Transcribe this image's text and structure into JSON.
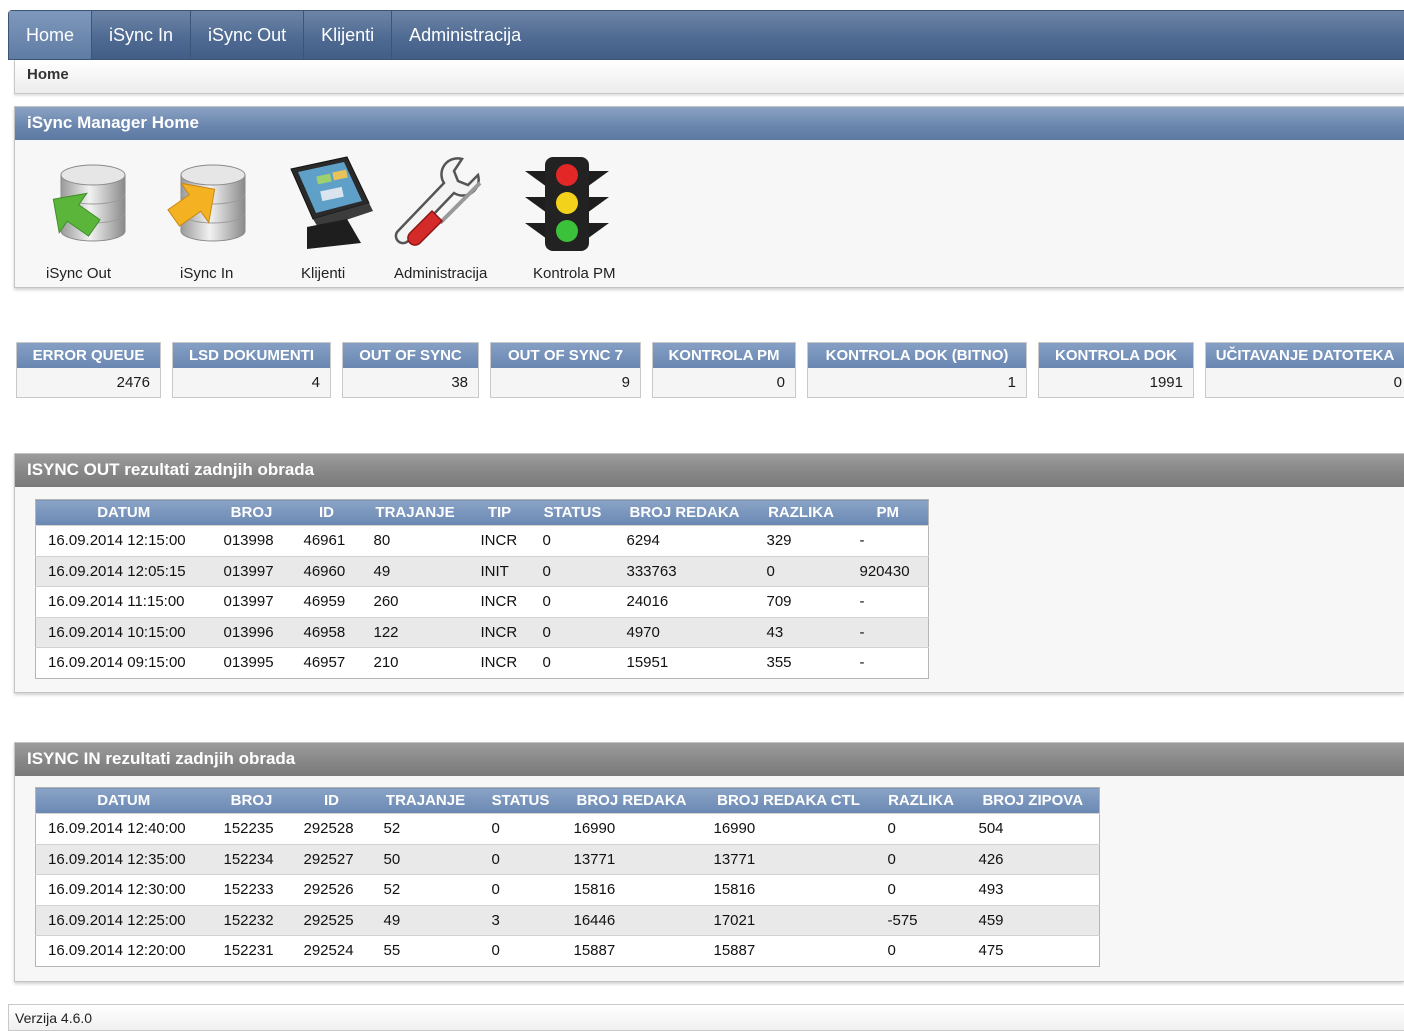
{
  "nav": {
    "tabs": [
      {
        "label": "Home",
        "active": true
      },
      {
        "label": "iSync In"
      },
      {
        "label": "iSync Out"
      },
      {
        "label": "Klijenti"
      },
      {
        "label": "Administracija"
      }
    ]
  },
  "breadcrumb": "Home",
  "home_region": {
    "title": "iSync Manager Home",
    "icons": [
      {
        "label": "iSync Out",
        "icon": "database-export-icon"
      },
      {
        "label": "iSync In",
        "icon": "database-import-icon"
      },
      {
        "label": "Klijenti",
        "icon": "pos-terminal-icon"
      },
      {
        "label": "Administracija",
        "icon": "wrench-screwdriver-icon"
      },
      {
        "label": "Kontrola PM",
        "icon": "traffic-light-icon"
      }
    ]
  },
  "stats": [
    {
      "label": "ERROR QUEUE",
      "value": "2476"
    },
    {
      "label": "LSD DOKUMENTI",
      "value": "4"
    },
    {
      "label": "OUT OF SYNC",
      "value": "38"
    },
    {
      "label": "OUT OF SYNC 7",
      "value": "9"
    },
    {
      "label": "KONTROLA PM",
      "value": "0"
    },
    {
      "label": "KONTROLA DOK (BITNO)",
      "value": "1"
    },
    {
      "label": "KONTROLA DOK",
      "value": "1991"
    },
    {
      "label": "UČITAVANJE DATOTEKA",
      "value": "0"
    }
  ],
  "isync_out": {
    "title": "ISYNC OUT rezultati zadnjih obrada",
    "columns": [
      "DATUM",
      "BROJ",
      "ID",
      "TRAJANJE",
      "TIP",
      "STATUS",
      "BROJ REDAKA",
      "RAZLIKA",
      "PM"
    ],
    "rows": [
      [
        "16.09.2014 12:15:00",
        "013998",
        "46961",
        "80",
        "INCR",
        "0",
        "6294",
        "329",
        "-"
      ],
      [
        "16.09.2014 12:05:15",
        "013997",
        "46960",
        "49",
        "INIT",
        "0",
        "333763",
        "0",
        "920430"
      ],
      [
        "16.09.2014 11:15:00",
        "013997",
        "46959",
        "260",
        "INCR",
        "0",
        "24016",
        "709",
        "-"
      ],
      [
        "16.09.2014 10:15:00",
        "013996",
        "46958",
        "122",
        "INCR",
        "0",
        "4970",
        "43",
        "-"
      ],
      [
        "16.09.2014 09:15:00",
        "013995",
        "46957",
        "210",
        "INCR",
        "0",
        "15951",
        "355",
        "-"
      ]
    ]
  },
  "isync_in": {
    "title": "ISYNC IN rezultati zadnjih obrada",
    "columns": [
      "DATUM",
      "BROJ",
      "ID",
      "TRAJANJE",
      "STATUS",
      "BROJ REDAKA",
      "BROJ REDAKA CTL",
      "RAZLIKA",
      "BROJ ZIPOVA"
    ],
    "rows": [
      [
        "16.09.2014 12:40:00",
        "152235",
        "292528",
        "52",
        "0",
        "16990",
        "16990",
        "0",
        "504"
      ],
      [
        "16.09.2014 12:35:00",
        "152234",
        "292527",
        "50",
        "0",
        "13771",
        "13771",
        "0",
        "426"
      ],
      [
        "16.09.2014 12:30:00",
        "152233",
        "292526",
        "52",
        "0",
        "15816",
        "15816",
        "0",
        "493"
      ],
      [
        "16.09.2014 12:25:00",
        "152232",
        "292525",
        "49",
        "3",
        "16446",
        "17021",
        "-575",
        "459"
      ],
      [
        "16.09.2014 12:20:00",
        "152231",
        "292524",
        "55",
        "0",
        "15887",
        "15887",
        "0",
        "475"
      ]
    ]
  },
  "footer": "Verzija 4.6.0"
}
